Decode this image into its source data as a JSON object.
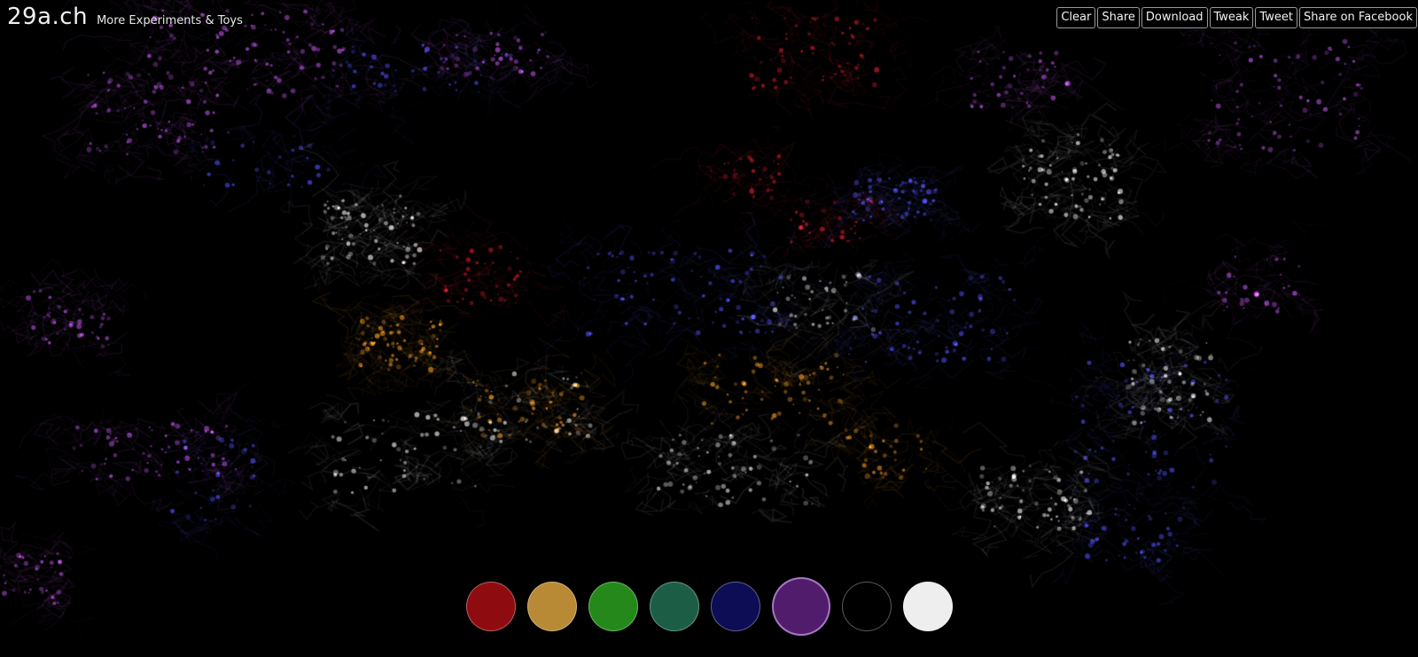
{
  "header": {
    "logo": "29a.ch",
    "more_link": "More Experiments & Toys"
  },
  "toolbar": {
    "buttons": [
      {
        "id": "clear",
        "label": "Clear"
      },
      {
        "id": "share",
        "label": "Share"
      },
      {
        "id": "download",
        "label": "Download"
      },
      {
        "id": "tweak",
        "label": "Tweak"
      },
      {
        "id": "tweet",
        "label": "Tweet"
      },
      {
        "id": "share-facebook",
        "label": "Share on Facebook"
      }
    ]
  },
  "palette": {
    "selected_index": 5,
    "colors": [
      {
        "name": "red",
        "hex": "#8e0c10"
      },
      {
        "name": "orange",
        "hex": "#b88a35"
      },
      {
        "name": "green",
        "hex": "#24891a"
      },
      {
        "name": "teal",
        "hex": "#1b5e45"
      },
      {
        "name": "navy",
        "hex": "#0d0d55"
      },
      {
        "name": "purple",
        "hex": "#521c6c"
      },
      {
        "name": "black",
        "hex": "#000000"
      },
      {
        "name": "white",
        "hex": "#eeeeee"
      }
    ]
  },
  "canvas": {
    "background": "#000000",
    "ink_colors": {
      "purple": "#b04ed8",
      "blue": "#4848e0",
      "white": "#dcdcdc",
      "orange": "#d98a20",
      "red": "#c01828"
    }
  }
}
